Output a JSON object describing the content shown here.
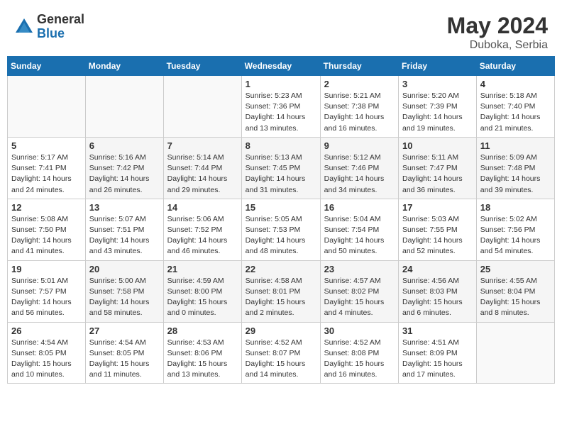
{
  "header": {
    "logo_general": "General",
    "logo_blue": "Blue",
    "title": "May 2024",
    "location": "Duboka, Serbia"
  },
  "days_of_week": [
    "Sunday",
    "Monday",
    "Tuesday",
    "Wednesday",
    "Thursday",
    "Friday",
    "Saturday"
  ],
  "weeks": [
    [
      {
        "day": "",
        "info": ""
      },
      {
        "day": "",
        "info": ""
      },
      {
        "day": "",
        "info": ""
      },
      {
        "day": "1",
        "info": "Sunrise: 5:23 AM\nSunset: 7:36 PM\nDaylight: 14 hours\nand 13 minutes."
      },
      {
        "day": "2",
        "info": "Sunrise: 5:21 AM\nSunset: 7:38 PM\nDaylight: 14 hours\nand 16 minutes."
      },
      {
        "day": "3",
        "info": "Sunrise: 5:20 AM\nSunset: 7:39 PM\nDaylight: 14 hours\nand 19 minutes."
      },
      {
        "day": "4",
        "info": "Sunrise: 5:18 AM\nSunset: 7:40 PM\nDaylight: 14 hours\nand 21 minutes."
      }
    ],
    [
      {
        "day": "5",
        "info": "Sunrise: 5:17 AM\nSunset: 7:41 PM\nDaylight: 14 hours\nand 24 minutes."
      },
      {
        "day": "6",
        "info": "Sunrise: 5:16 AM\nSunset: 7:42 PM\nDaylight: 14 hours\nand 26 minutes."
      },
      {
        "day": "7",
        "info": "Sunrise: 5:14 AM\nSunset: 7:44 PM\nDaylight: 14 hours\nand 29 minutes."
      },
      {
        "day": "8",
        "info": "Sunrise: 5:13 AM\nSunset: 7:45 PM\nDaylight: 14 hours\nand 31 minutes."
      },
      {
        "day": "9",
        "info": "Sunrise: 5:12 AM\nSunset: 7:46 PM\nDaylight: 14 hours\nand 34 minutes."
      },
      {
        "day": "10",
        "info": "Sunrise: 5:11 AM\nSunset: 7:47 PM\nDaylight: 14 hours\nand 36 minutes."
      },
      {
        "day": "11",
        "info": "Sunrise: 5:09 AM\nSunset: 7:48 PM\nDaylight: 14 hours\nand 39 minutes."
      }
    ],
    [
      {
        "day": "12",
        "info": "Sunrise: 5:08 AM\nSunset: 7:50 PM\nDaylight: 14 hours\nand 41 minutes."
      },
      {
        "day": "13",
        "info": "Sunrise: 5:07 AM\nSunset: 7:51 PM\nDaylight: 14 hours\nand 43 minutes."
      },
      {
        "day": "14",
        "info": "Sunrise: 5:06 AM\nSunset: 7:52 PM\nDaylight: 14 hours\nand 46 minutes."
      },
      {
        "day": "15",
        "info": "Sunrise: 5:05 AM\nSunset: 7:53 PM\nDaylight: 14 hours\nand 48 minutes."
      },
      {
        "day": "16",
        "info": "Sunrise: 5:04 AM\nSunset: 7:54 PM\nDaylight: 14 hours\nand 50 minutes."
      },
      {
        "day": "17",
        "info": "Sunrise: 5:03 AM\nSunset: 7:55 PM\nDaylight: 14 hours\nand 52 minutes."
      },
      {
        "day": "18",
        "info": "Sunrise: 5:02 AM\nSunset: 7:56 PM\nDaylight: 14 hours\nand 54 minutes."
      }
    ],
    [
      {
        "day": "19",
        "info": "Sunrise: 5:01 AM\nSunset: 7:57 PM\nDaylight: 14 hours\nand 56 minutes."
      },
      {
        "day": "20",
        "info": "Sunrise: 5:00 AM\nSunset: 7:58 PM\nDaylight: 14 hours\nand 58 minutes."
      },
      {
        "day": "21",
        "info": "Sunrise: 4:59 AM\nSunset: 8:00 PM\nDaylight: 15 hours\nand 0 minutes."
      },
      {
        "day": "22",
        "info": "Sunrise: 4:58 AM\nSunset: 8:01 PM\nDaylight: 15 hours\nand 2 minutes."
      },
      {
        "day": "23",
        "info": "Sunrise: 4:57 AM\nSunset: 8:02 PM\nDaylight: 15 hours\nand 4 minutes."
      },
      {
        "day": "24",
        "info": "Sunrise: 4:56 AM\nSunset: 8:03 PM\nDaylight: 15 hours\nand 6 minutes."
      },
      {
        "day": "25",
        "info": "Sunrise: 4:55 AM\nSunset: 8:04 PM\nDaylight: 15 hours\nand 8 minutes."
      }
    ],
    [
      {
        "day": "26",
        "info": "Sunrise: 4:54 AM\nSunset: 8:05 PM\nDaylight: 15 hours\nand 10 minutes."
      },
      {
        "day": "27",
        "info": "Sunrise: 4:54 AM\nSunset: 8:05 PM\nDaylight: 15 hours\nand 11 minutes."
      },
      {
        "day": "28",
        "info": "Sunrise: 4:53 AM\nSunset: 8:06 PM\nDaylight: 15 hours\nand 13 minutes."
      },
      {
        "day": "29",
        "info": "Sunrise: 4:52 AM\nSunset: 8:07 PM\nDaylight: 15 hours\nand 14 minutes."
      },
      {
        "day": "30",
        "info": "Sunrise: 4:52 AM\nSunset: 8:08 PM\nDaylight: 15 hours\nand 16 minutes."
      },
      {
        "day": "31",
        "info": "Sunrise: 4:51 AM\nSunset: 8:09 PM\nDaylight: 15 hours\nand 17 minutes."
      },
      {
        "day": "",
        "info": ""
      }
    ]
  ]
}
